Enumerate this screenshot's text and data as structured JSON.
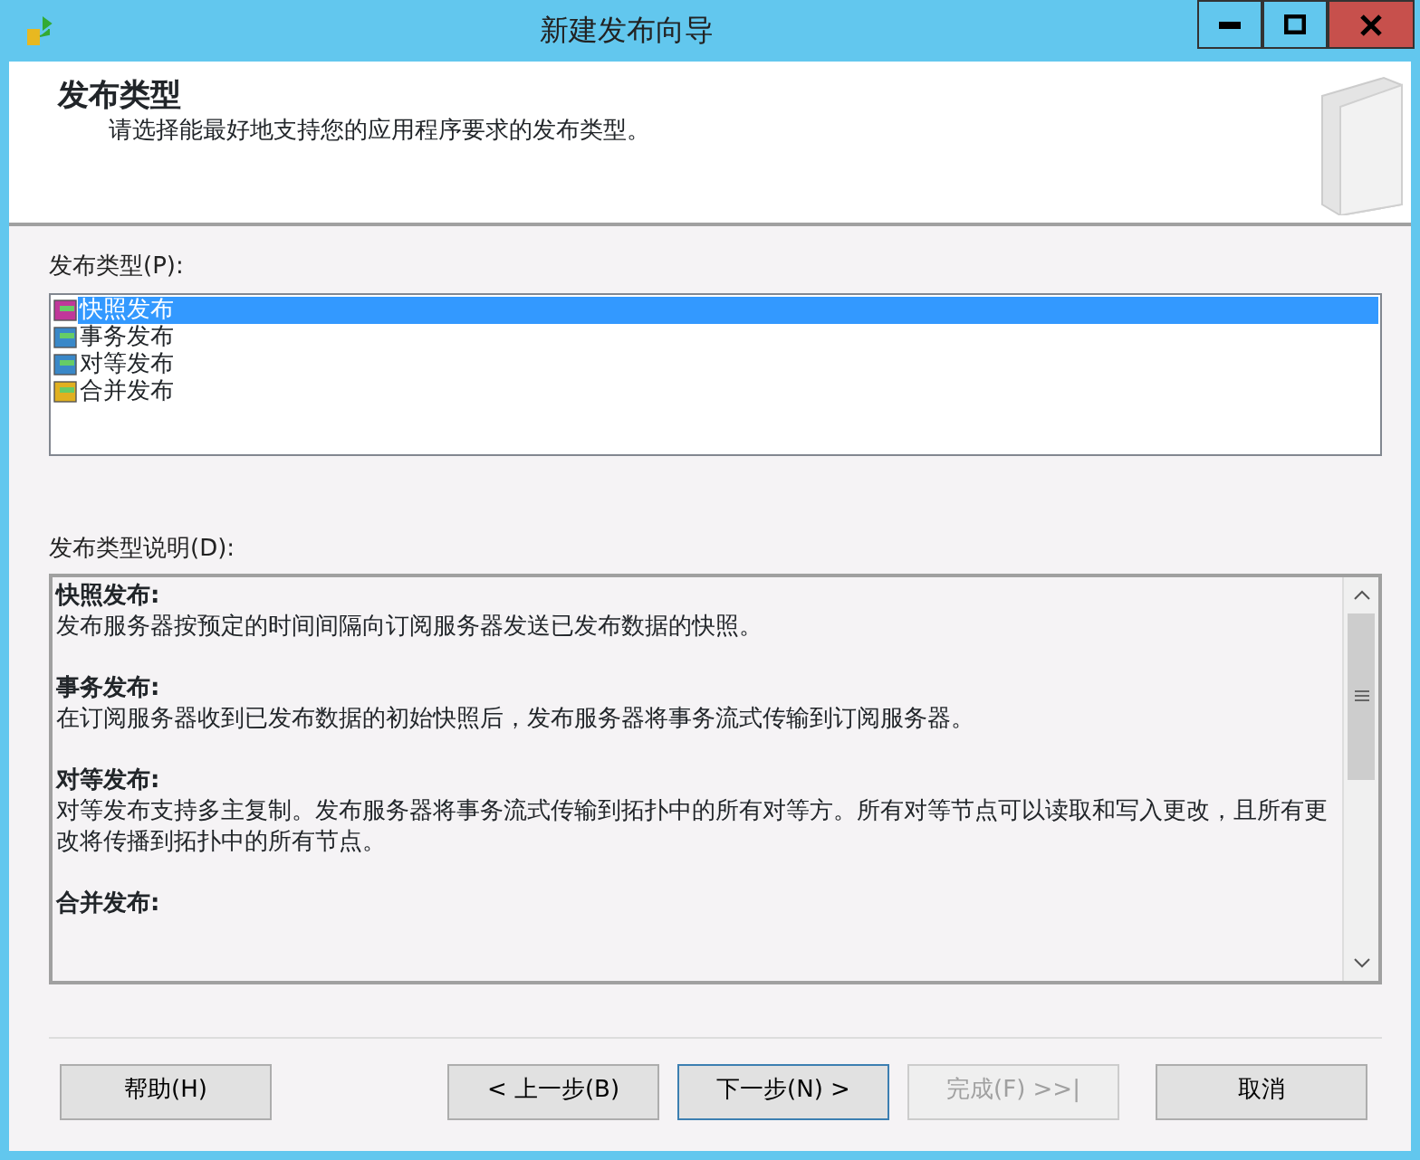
{
  "window": {
    "title": "新建发布向导"
  },
  "header": {
    "title": "发布类型",
    "subtitle": "请选择能最好地支持您的应用程序要求的发布类型。"
  },
  "type_list": {
    "label": "发布类型(P):",
    "items": [
      {
        "label": "快照发布",
        "kind": "snapshot",
        "selected": true
      },
      {
        "label": "事务发布",
        "kind": "transactional",
        "selected": false
      },
      {
        "label": "对等发布",
        "kind": "peer",
        "selected": false
      },
      {
        "label": "合并发布",
        "kind": "merge",
        "selected": false
      }
    ]
  },
  "description": {
    "label": "发布类型说明(D):",
    "sections": [
      {
        "title": "快照发布:",
        "text": "发布服务器按预定的时间间隔向订阅服务器发送已发布数据的快照。"
      },
      {
        "title": "事务发布:",
        "text": "在订阅服务器收到已发布数据的初始快照后，发布服务器将事务流式传输到订阅服务器。"
      },
      {
        "title": "对等发布:",
        "text": "对等发布支持多主复制。发布服务器将事务流式传输到拓扑中的所有对等方。所有对等节点可以读取和写入更改，且所有更改将传播到拓扑中的所有节点。"
      },
      {
        "title": "合并发布:"
      }
    ]
  },
  "buttons": [
    {
      "label": "帮助(H)",
      "disabled": false,
      "default": false
    },
    {
      "label": "< 上一步(B)",
      "disabled": false,
      "default": false
    },
    {
      "label": "下一步(N) >",
      "disabled": false,
      "default": true
    },
    {
      "label": "完成(F) >>|",
      "disabled": true,
      "default": false
    },
    {
      "label": "取消",
      "disabled": false,
      "default": false
    }
  ]
}
